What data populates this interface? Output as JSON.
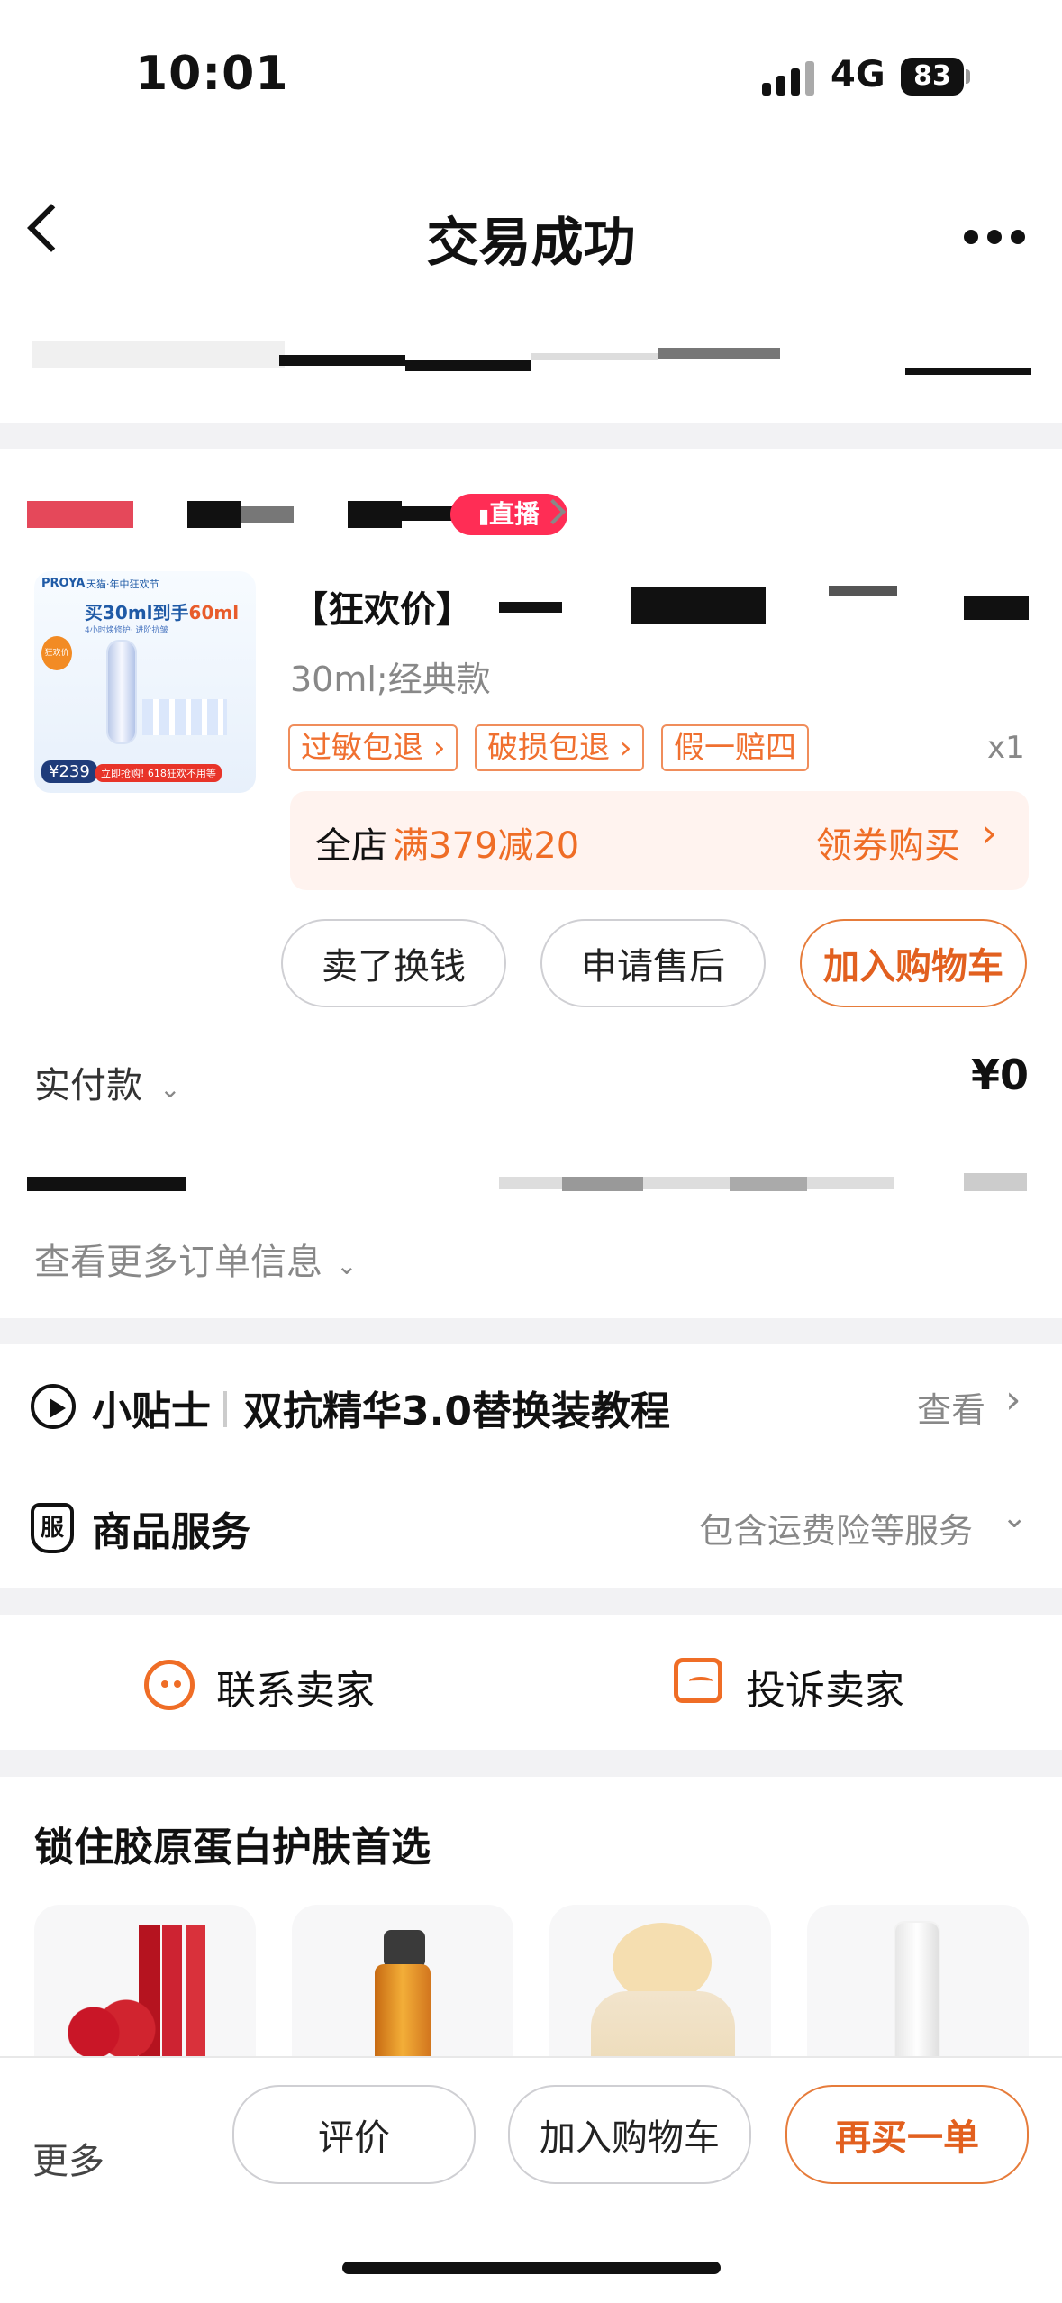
{
  "status_bar": {
    "time": "10:01",
    "network": "4G",
    "battery": "83"
  },
  "header": {
    "title": "交易成功"
  },
  "shop": {
    "live_badge": "直播"
  },
  "product": {
    "thumb_brand": "PROYA",
    "thumb_event": "天猫·年中狂欢节",
    "thumb_headline_prefix": "买30ml到手",
    "thumb_headline_highlight": "60ml",
    "thumb_subline": "4小时焕修护· 进阶抗皱",
    "thumb_badge": "狂欢价",
    "thumb_price": "¥239",
    "thumb_footer": "立即抢购! 618狂欢不用等",
    "title_prefix": "【狂欢价】",
    "variant": "30ml;经典款",
    "tags": [
      "过敏包退",
      "破损包退",
      "假一赔四"
    ],
    "qty": "x1",
    "promo_left_static": "全店",
    "promo_left_value": "满379减20",
    "promo_right": "领券购买"
  },
  "actions": {
    "sell_label": "卖了换钱",
    "after_sale_label": "申请售后",
    "add_cart_label": "加入购物车"
  },
  "payment": {
    "label": "实付款",
    "value": "¥0"
  },
  "order_more": {
    "label": "查看更多订单信息"
  },
  "tips": {
    "label": "小贴士",
    "text": "双抗精华3.0替换装教程",
    "action": "查看"
  },
  "service": {
    "icon_text": "服",
    "label": "商品服务",
    "detail": "包含运费险等服务"
  },
  "contact": {
    "seller_label": "联系卖家",
    "complain_label": "投诉卖家"
  },
  "recommend": {
    "title": "锁住胶原蛋白护肤首选"
  },
  "footer": {
    "more_label": "更多",
    "review_label": "评价",
    "add_cart_label": "加入购物车",
    "buy_again_label": "再买一单"
  },
  "colors": {
    "accent": "#f06a1f",
    "live": "#ff2d55",
    "muted": "#8a8a8a"
  }
}
